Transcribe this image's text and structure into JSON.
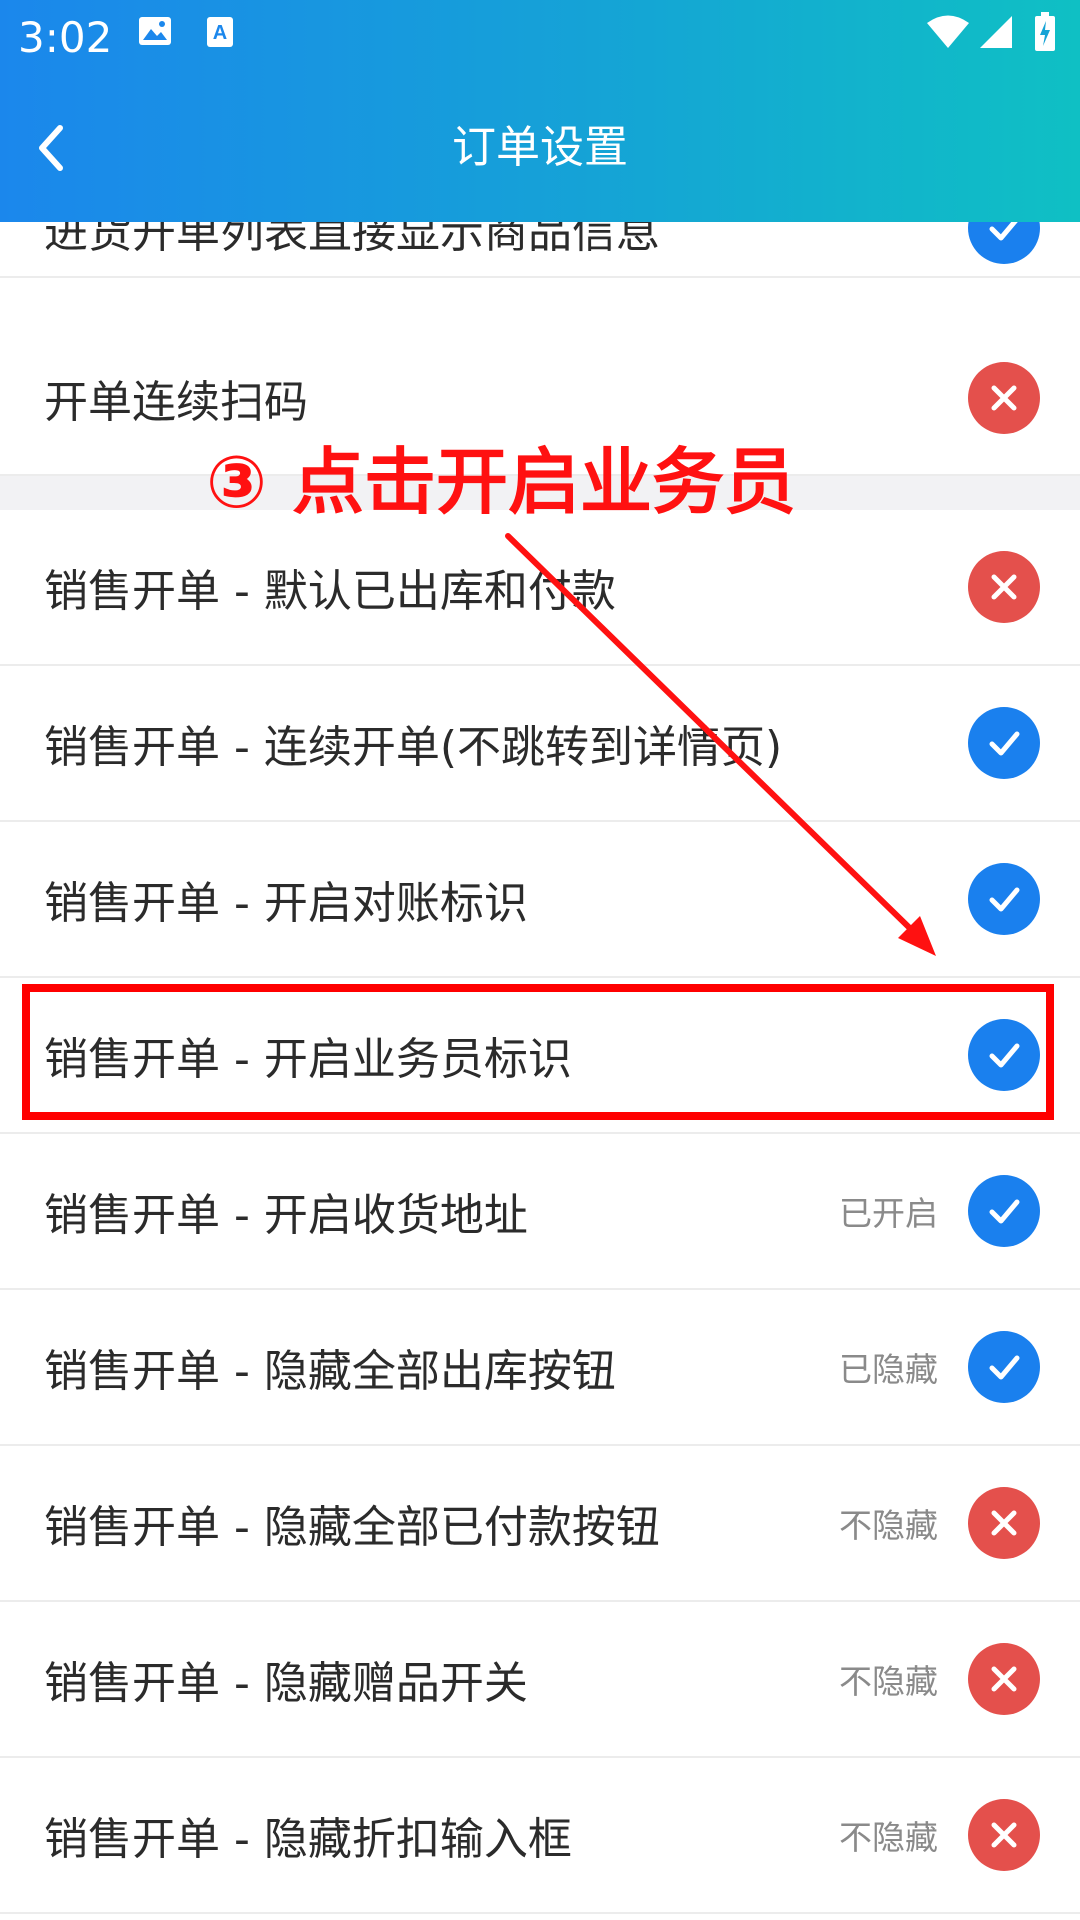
{
  "status_bar": {
    "time": "3:02",
    "icons": [
      "image-icon",
      "text-a-icon",
      "wifi-icon",
      "signal-icon",
      "battery-icon"
    ]
  },
  "header": {
    "back_icon": "chevron-left-icon",
    "title": "订单设置"
  },
  "colors": {
    "header_gradient": [
      "#1b87ec",
      "#0fc0c4"
    ],
    "toggle_on": "#1a80ee",
    "toggle_off": "#e4504c",
    "annotation": "#ff0000"
  },
  "settings": [
    {
      "label": "进货开单列表直接显示商品信息",
      "status": "",
      "enabled": true
    },
    {
      "label": "开单连续扫码",
      "status": "",
      "enabled": false
    },
    {
      "label": "销售开单 - 默认已出库和付款",
      "status": "",
      "enabled": false
    },
    {
      "label": "销售开单 - 连续开单(不跳转到详情页)",
      "status": "",
      "enabled": true
    },
    {
      "label": "销售开单 - 开启对账标识",
      "status": "",
      "enabled": true
    },
    {
      "label": "销售开单 - 开启业务员标识",
      "status": "",
      "enabled": true
    },
    {
      "label": "销售开单 - 开启收货地址",
      "status": "已开启",
      "enabled": true
    },
    {
      "label": "销售开单 - 隐藏全部出库按钮",
      "status": "已隐藏",
      "enabled": true
    },
    {
      "label": "销售开单 - 隐藏全部已付款按钮",
      "status": "不隐藏",
      "enabled": false
    },
    {
      "label": "销售开单 - 隐藏赠品开关",
      "status": "不隐藏",
      "enabled": false
    },
    {
      "label": "销售开单 - 隐藏折扣输入框",
      "status": "不隐藏",
      "enabled": false
    }
  ],
  "annotation": {
    "text": "③ 点击开启业务员"
  }
}
